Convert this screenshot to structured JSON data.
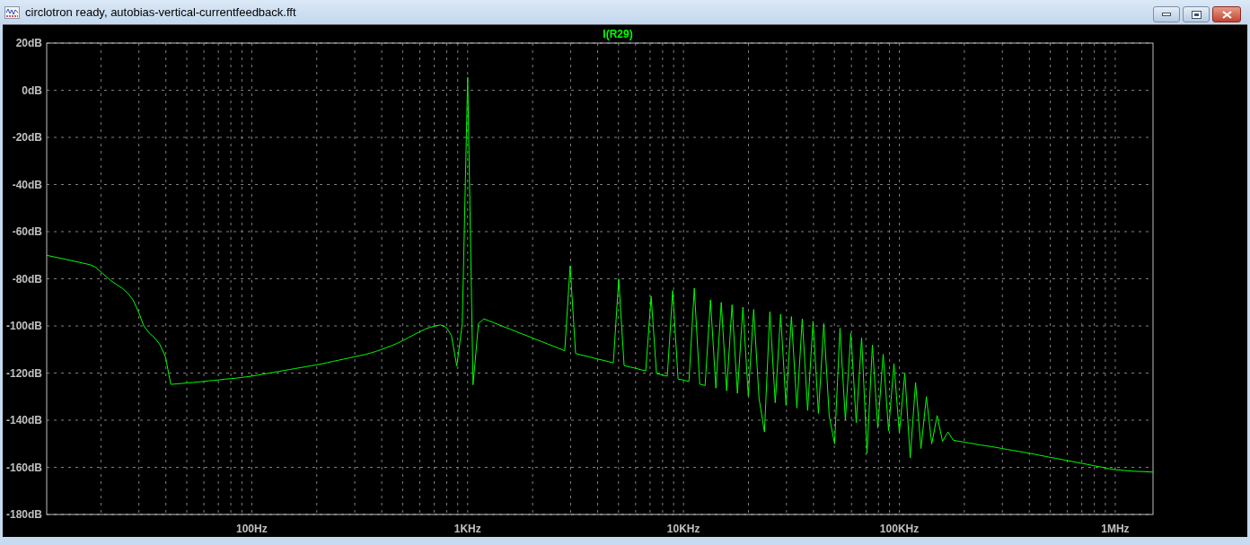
{
  "window": {
    "title": "circlotron ready, autobias-vertical-currentfeedback.fft"
  },
  "plot": {
    "chart_data": {
      "type": "line",
      "grid": true,
      "ylim": [
        -180,
        20
      ],
      "categories": [
        null,
        null,
        null,
        null,
        null,
        null,
        null,
        null,
        null,
        null,
        null,
        null,
        null,
        null,
        null,
        null,
        null,
        null,
        null,
        null,
        null,
        null,
        null,
        null,
        null,
        null,
        null,
        null,
        null,
        null,
        null,
        null,
        null,
        null,
        null,
        null,
        null,
        null,
        "100Hz",
        null,
        null,
        null,
        null,
        null,
        null,
        null,
        null,
        null,
        null,
        null,
        null,
        null,
        null,
        null,
        null,
        null,
        null,
        null,
        null,
        null,
        null,
        null,
        null,
        null,
        null,
        null,
        null,
        null,
        null,
        null,
        null,
        null,
        null,
        null,
        null,
        null,
        null,
        null,
        "1KHz",
        null,
        null,
        null,
        null,
        null,
        null,
        null,
        null,
        null,
        null,
        null,
        null,
        null,
        null,
        null,
        null,
        null,
        null,
        null,
        null,
        null,
        null,
        null,
        null,
        null,
        null,
        null,
        null,
        null,
        null,
        null,
        null,
        null,
        null,
        null,
        null,
        null,
        null,
        null,
        "10KHz",
        null,
        null,
        null,
        null,
        null,
        null,
        null,
        null,
        null,
        null,
        null,
        null,
        null,
        null,
        null,
        null,
        null,
        null,
        null,
        null,
        null,
        null,
        null,
        null,
        null,
        null,
        null,
        null,
        null,
        null,
        null,
        null,
        null,
        null,
        null,
        null,
        null,
        null,
        null,
        "100KHz",
        null,
        null,
        null,
        null,
        null,
        null,
        null,
        null,
        null,
        null,
        null,
        null,
        null,
        null,
        null,
        null,
        null,
        null,
        null,
        null,
        null,
        null,
        null,
        null,
        null,
        null,
        null,
        null,
        null,
        null,
        null,
        null,
        null,
        null,
        null,
        null,
        null,
        null,
        null,
        "1MHz",
        null,
        null,
        null,
        null,
        null,
        null,
        null
      ],
      "yticks": [
        {
          "value": 20,
          "label": "20dB"
        },
        {
          "value": 0,
          "label": "0dB"
        },
        {
          "value": -20,
          "label": "-20dB"
        },
        {
          "value": -40,
          "label": "-40dB"
        },
        {
          "value": -60,
          "label": "-60dB"
        },
        {
          "value": -80,
          "label": "-80dB"
        },
        {
          "value": -100,
          "label": "-100dB"
        },
        {
          "value": -120,
          "label": "-120dB"
        },
        {
          "value": -140,
          "label": "-140dB"
        },
        {
          "value": -160,
          "label": "-160dB"
        },
        {
          "value": -180,
          "label": "-180dB"
        }
      ],
      "series": [
        {
          "name": "I(R29)",
          "color": "#00ff00",
          "values": [
            -70,
            -70.5,
            -71,
            -71.5,
            -72,
            -72.5,
            -73,
            -73.5,
            -74,
            -75,
            -77,
            -79,
            -81,
            -82.5,
            -84,
            -86,
            -89,
            -94,
            -100,
            -103,
            -105,
            -108,
            -113,
            -124.8,
            -124.6,
            -124.4,
            -124.2,
            -124,
            -123.8,
            -123.6,
            -123.3,
            -123.1,
            -122.9,
            -122.6,
            -122.4,
            -122.2,
            -121.9,
            -121.6,
            -121.3,
            -120.9,
            -120.5,
            -120.1,
            -119.7,
            -119.3,
            -118.9,
            -118.5,
            -118.1,
            -117.7,
            -117.3,
            -116.9,
            -116.5,
            -116.1,
            -115.6,
            -115.1,
            -114.6,
            -114.1,
            -113.6,
            -113.1,
            -112.6,
            -112.1,
            -111.5,
            -110.8,
            -110,
            -109.2,
            -108.3,
            -107.3,
            -106.2,
            -105,
            -103.8,
            -102.6,
            -101.5,
            -100.6,
            -100,
            -99.6,
            -100.5,
            -104,
            -117,
            -99,
            5.5,
            -125,
            -99,
            -97,
            -97.9,
            -98.8,
            -99.7,
            -100.6,
            -101.5,
            -102.4,
            -103.3,
            -104.2,
            -105.1,
            -106,
            -106.9,
            -107.8,
            -108.7,
            -109.6,
            -110.5,
            -74.5,
            -111.7,
            -112.3,
            -112.8,
            -113.4,
            -114,
            -114.5,
            -115.1,
            -115.7,
            -80,
            -116.8,
            -117.4,
            -117.9,
            -118.5,
            -119.1,
            -87.4,
            -120.2,
            -120.8,
            -121.3,
            -85,
            -122.5,
            -123,
            -123.6,
            -84,
            -124.7,
            -125.3,
            -89,
            -126.4,
            -90,
            -127.5,
            -91,
            -128.6,
            -92,
            -129.8,
            -93,
            -130.9,
            -145,
            -94,
            -132.6,
            -95,
            -133.7,
            -96,
            -134.8,
            -97,
            -135.9,
            -98,
            -137.1,
            -99,
            -138.2,
            -150,
            -101,
            -139.9,
            -103,
            -141,
            -105,
            -154,
            -108,
            -143.3,
            -112,
            -144.4,
            -116,
            -145.5,
            -120,
            -156,
            -124,
            -152,
            -130,
            -150,
            -138,
            -149,
            -145,
            -148.5,
            -148.9,
            -149.3,
            -149.7,
            -150.1,
            -150.5,
            -150.8,
            -151.2,
            -151.6,
            -152,
            -152.4,
            -152.8,
            -153.2,
            -153.6,
            -154,
            -154.4,
            -154.9,
            -155.3,
            -155.8,
            -156.2,
            -156.6,
            -157.1,
            -157.5,
            -158,
            -158.4,
            -158.8,
            -159.3,
            -159.7,
            -160.2,
            -160.6,
            -161,
            -161.2,
            -161.4,
            -161.6,
            -161.7,
            -161.8,
            -161.9,
            -162
          ]
        }
      ]
    }
  }
}
